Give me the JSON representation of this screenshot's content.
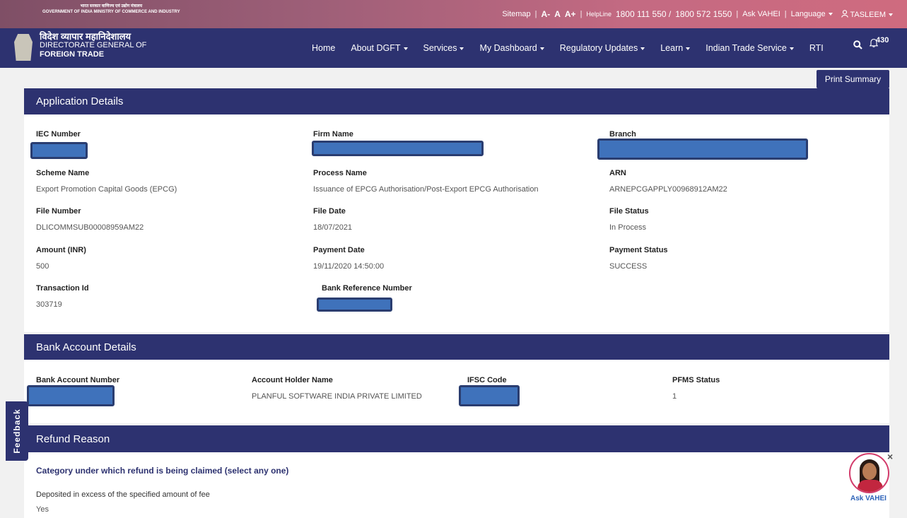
{
  "header": {
    "gov_hindi": "भारत सरकार   वाणिज्य एवं उद्योग मंत्रालय",
    "gov_english": "GOVERNMENT OF INDIA   MINISTRY OF COMMERCE AND INDUSTRY",
    "sitemap": "Sitemap",
    "font_decrease": "A-",
    "font_normal": "A",
    "font_increase": "A+",
    "helpline_label": "HelpLine",
    "helpline_1": "1800 111 550 /",
    "helpline_2": "1800 572 1550",
    "ask_vahei": "Ask VAHEI",
    "language": "Language",
    "user": "TASLEEM"
  },
  "brand": {
    "hindi": "विदेश व्यापार महानिदेशालय",
    "line1": "DIRECTORATE GENERAL OF",
    "line2": "FOREIGN TRADE"
  },
  "nav": {
    "home": "Home",
    "about": "About DGFT",
    "services": "Services",
    "dashboard": "My Dashboard",
    "regulatory": "Regulatory Updates",
    "learn": "Learn",
    "its": "Indian Trade Service",
    "rti": "RTI",
    "notification_count": "430"
  },
  "actions": {
    "print_summary": "Print Summary"
  },
  "application": {
    "title": "Application Details",
    "iec_label": "IEC Number",
    "firm_label": "Firm Name",
    "branch_label": "Branch",
    "scheme_label": "Scheme Name",
    "scheme_value": "Export Promotion Capital Goods (EPCG)",
    "process_label": "Process Name",
    "process_value": "Issuance of EPCG Authorisation/Post-Export EPCG Authorisation",
    "arn_label": "ARN",
    "arn_value": "ARNEPCGAPPLY00968912AM22",
    "file_number_label": "File Number",
    "file_number_value": "DLICOMMSUB00008959AM22",
    "file_date_label": "File Date",
    "file_date_value": "18/07/2021",
    "file_status_label": "File Status",
    "file_status_value": "In Process",
    "amount_label": "Amount (INR)",
    "amount_value": "500",
    "payment_date_label": "Payment Date",
    "payment_date_value": "19/11/2020 14:50:00",
    "payment_status_label": "Payment Status",
    "payment_status_value": "SUCCESS",
    "txn_label": "Transaction Id",
    "txn_value": "303719",
    "bank_ref_label": "Bank Reference Number"
  },
  "bank": {
    "title": "Bank Account Details",
    "account_label": "Bank Account Number",
    "holder_label": "Account Holder Name",
    "holder_value": "PLANFUL SOFTWARE INDIA PRIVATE LIMITED",
    "ifsc_label": "IFSC Code",
    "pfms_label": "PFMS Status",
    "pfms_value": "1"
  },
  "refund": {
    "title": "Refund Reason",
    "category_heading": "Category under which refund is being claimed (select any one)",
    "reason_label": "Deposited in excess of the specified amount of fee",
    "reason_value": "Yes"
  },
  "widgets": {
    "feedback": "Feedback",
    "ask_vahei": "Ask VAHEI",
    "close": "×"
  }
}
